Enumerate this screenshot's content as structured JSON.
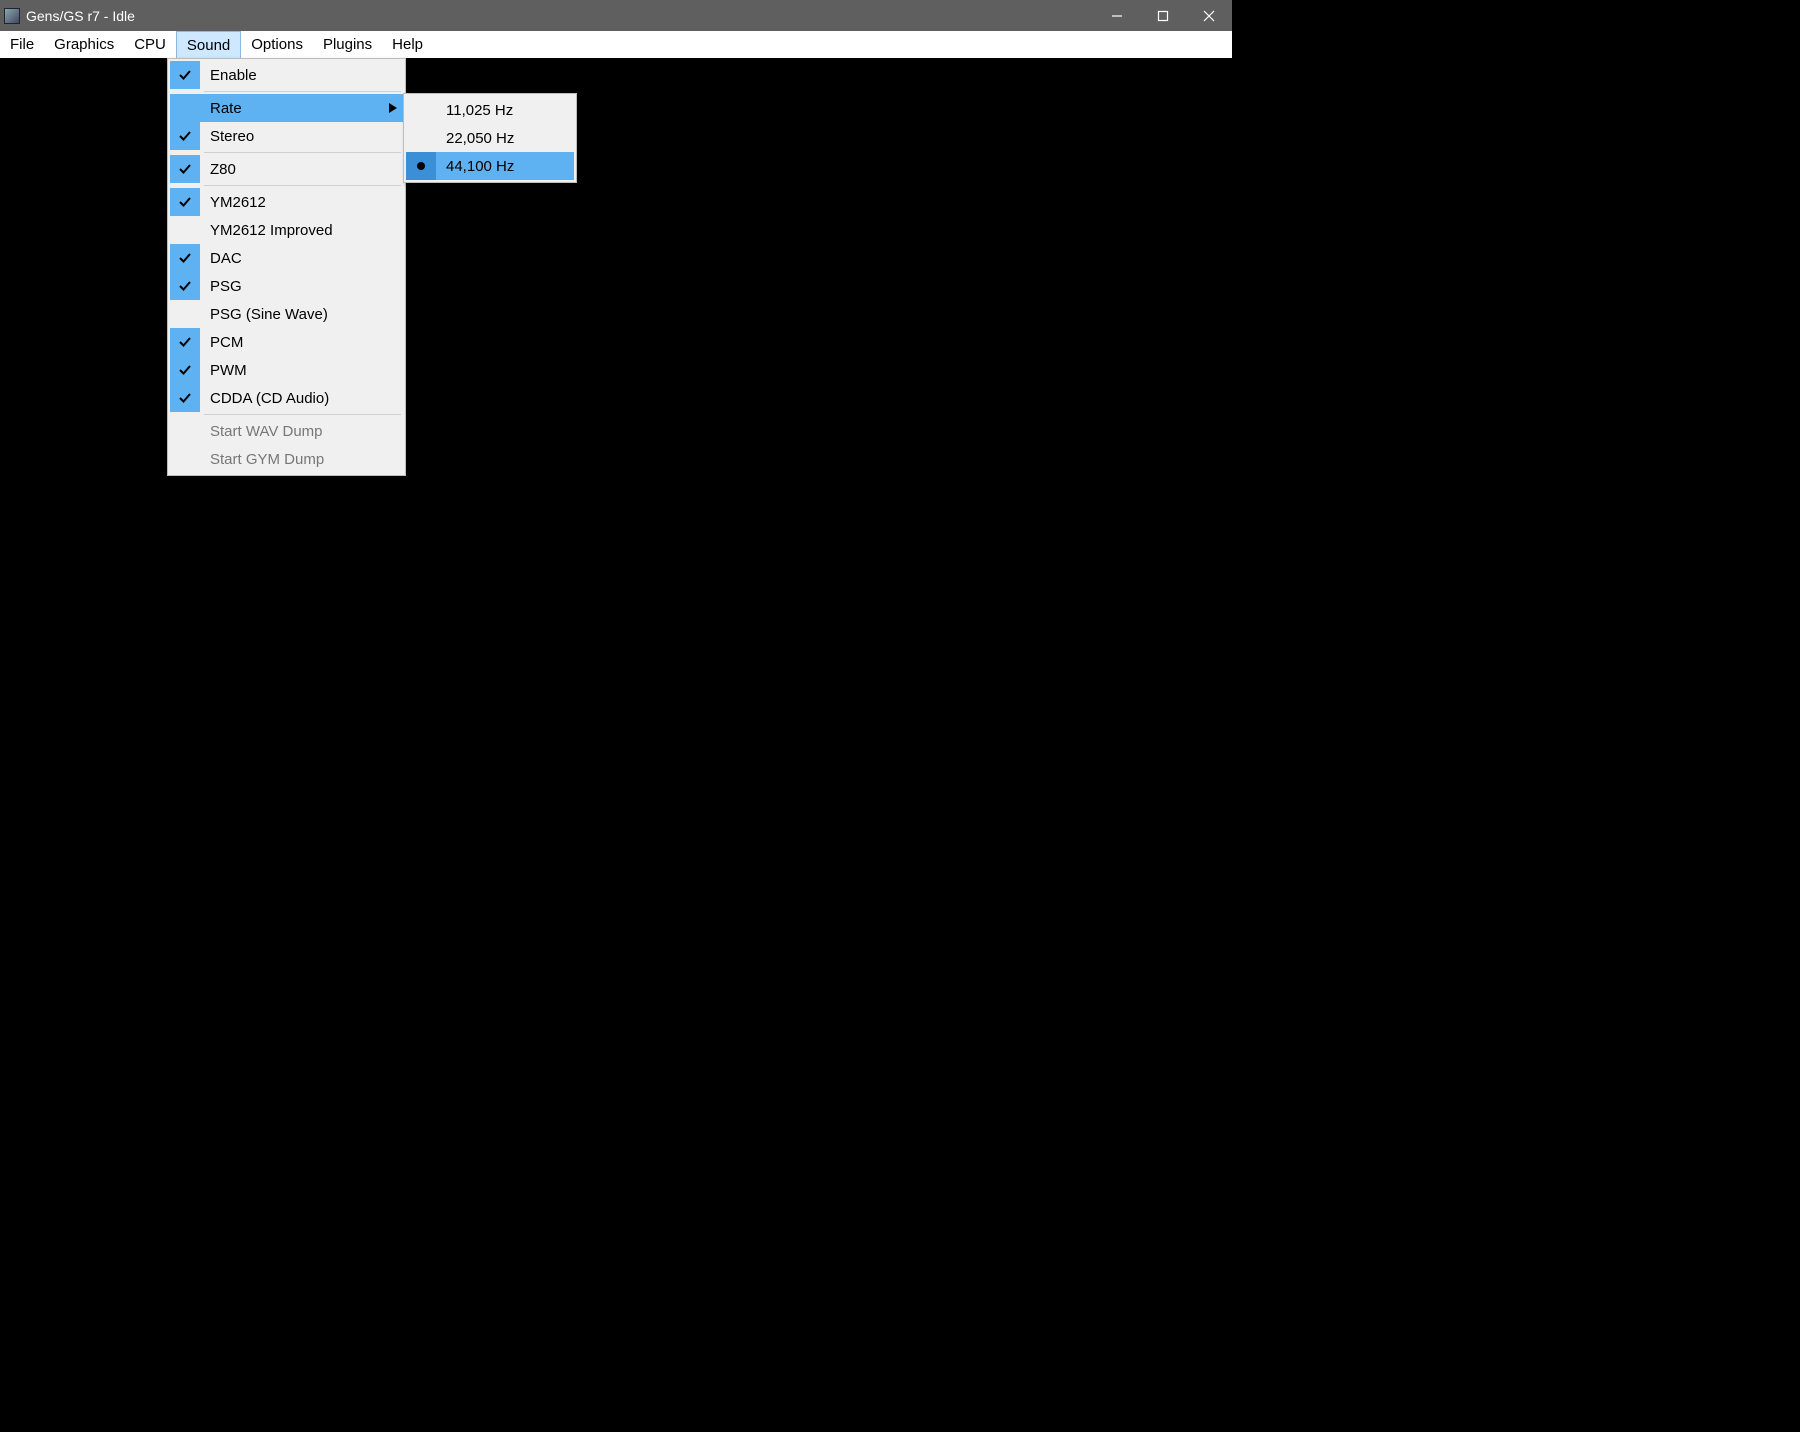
{
  "window": {
    "title": "Gens/GS r7 - Idle"
  },
  "menubar": {
    "items": [
      {
        "label": "File"
      },
      {
        "label": "Graphics"
      },
      {
        "label": "CPU"
      },
      {
        "label": "Sound"
      },
      {
        "label": "Options"
      },
      {
        "label": "Plugins"
      },
      {
        "label": "Help"
      }
    ],
    "open_index": 3
  },
  "sound_menu": {
    "enable": "Enable",
    "rate": "Rate",
    "stereo": "Stereo",
    "z80": "Z80",
    "ym2612": "YM2612",
    "ym2612_improved": "YM2612 Improved",
    "dac": "DAC",
    "psg": "PSG",
    "psg_sine": "PSG (Sine Wave)",
    "pcm": "PCM",
    "pwm": "PWM",
    "cdda": "CDDA (CD Audio)",
    "start_wav": "Start WAV Dump",
    "start_gym": "Start GYM Dump"
  },
  "rate_submenu": {
    "r0": "11,025 Hz",
    "r1": "22,050 Hz",
    "r2": "44,100 Hz"
  }
}
